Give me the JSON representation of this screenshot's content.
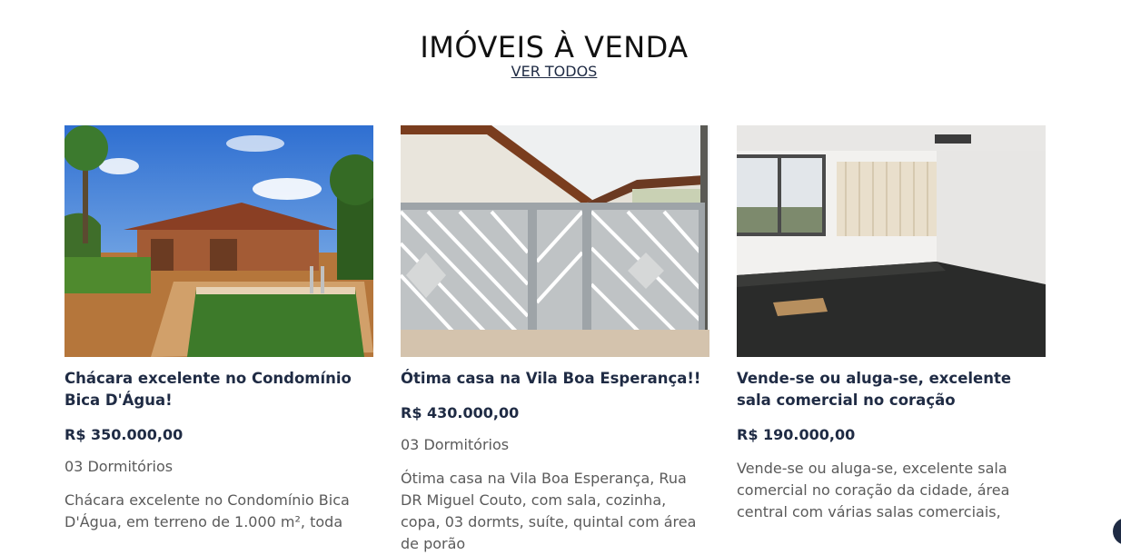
{
  "section": {
    "title": "IMÓVEIS À VENDA",
    "see_all": "VER TODOS"
  },
  "listings": [
    {
      "title": "Chácara excelente no Condomínio Bica D'Água!",
      "price": "R$ 350.000,00",
      "rooms": "03 Dormitórios",
      "description": "Chácara excelente no Condomínio Bica D'Água, em terreno de 1.000 m², toda",
      "image": "pool-house-photo"
    },
    {
      "title": "Ótima casa na Vila Boa Esperança!!",
      "price": "R$ 430.000,00",
      "rooms": "03 Dormitórios",
      "description": "Ótima casa na Vila Boa Esperança, Rua DR Miguel Couto, com sala, cozinha, copa, 03 dormts, suíte, quintal com área de porão",
      "image": "house-gate-photo"
    },
    {
      "title": "Vende-se ou aluga-se, excelente sala comercial no coração",
      "price": "R$ 190.000,00",
      "rooms": "",
      "description": "Vende-se ou aluga-se, excelente sala comercial no coração da cidade, área central com várias salas comerciais,",
      "image": "empty-office-photo"
    }
  ],
  "colors": {
    "navy": "#1f2b44",
    "text_gray": "#5a5a5a"
  }
}
